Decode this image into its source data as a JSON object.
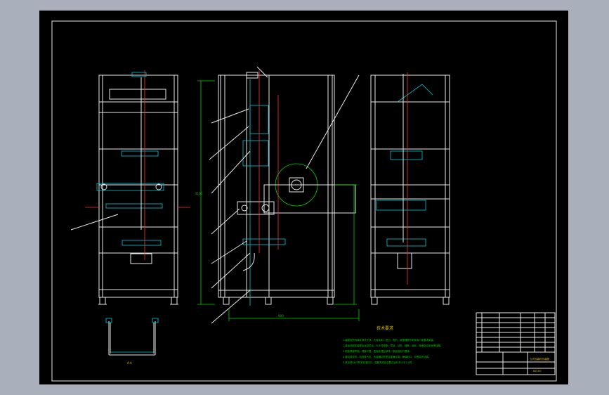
{
  "drawing": {
    "notes_title": "技术要求",
    "notes": [
      "1.装配前所有零件清洗干净，去除毛刺、锐边，电机、减速器等外购件按厂家要求安装。",
      "2.各运动部件装配后运动灵活，无卡滞现象；导轨、丝杠、链条、齿轮、轴承处应加润滑油脂。",
      "3.机架焊接牢固，焊缝平整；表面处理后喷漆，颜色按用户要求。",
      "4.整机调试时，检查各气缸、传感器动作是否准确可靠，确保封口、切断同步协调。",
      "5.其余按GB/T有关标准执行，装配完成后空载试运行不少于2小时。"
    ],
    "section_label": "A-A",
    "width_dim_label": "900",
    "height_dim_label": "2100",
    "title_block": {
      "drawing_name": "立式包装机总装图",
      "drawing_no": "BZJ-00"
    }
  },
  "colors": {
    "frame": "#e8e8e8",
    "dimension": "#00d200",
    "centerline": "#ff3030",
    "part": "#00c8d8",
    "text": "#e0c000"
  }
}
